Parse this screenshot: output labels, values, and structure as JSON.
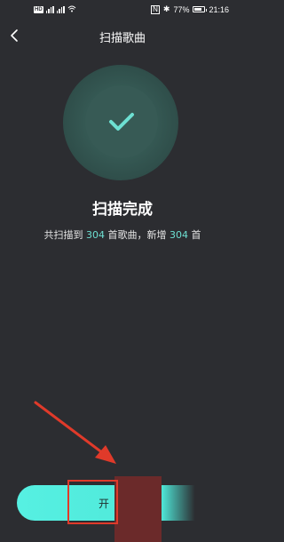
{
  "status_bar": {
    "network_badge": "HD",
    "signal_1": "⁴ᴳ",
    "signal_2": "⁴ᴳ",
    "nfc": "N",
    "bluetooth": "✱",
    "battery_percent": "77%",
    "battery_level": 0.77,
    "time": "21:16"
  },
  "nav": {
    "back_icon": "chevron-left-icon",
    "title": "扫描歌曲"
  },
  "success": {
    "icon": "check-icon",
    "colors": {
      "accent": "#6de0d2",
      "ring_outer": "#2f4e4a",
      "ring_inner": "#375a55"
    }
  },
  "result": {
    "title": "扫描完成",
    "desc_part1": "共扫描到 ",
    "scanned_count": "304",
    "desc_part2": " 首歌曲，新增 ",
    "added_count": "304",
    "desc_part3": " 首"
  },
  "bottom": {
    "start_button_label": "开",
    "button_color": "#56f0e2",
    "annotation_color": "#e03a2a"
  }
}
